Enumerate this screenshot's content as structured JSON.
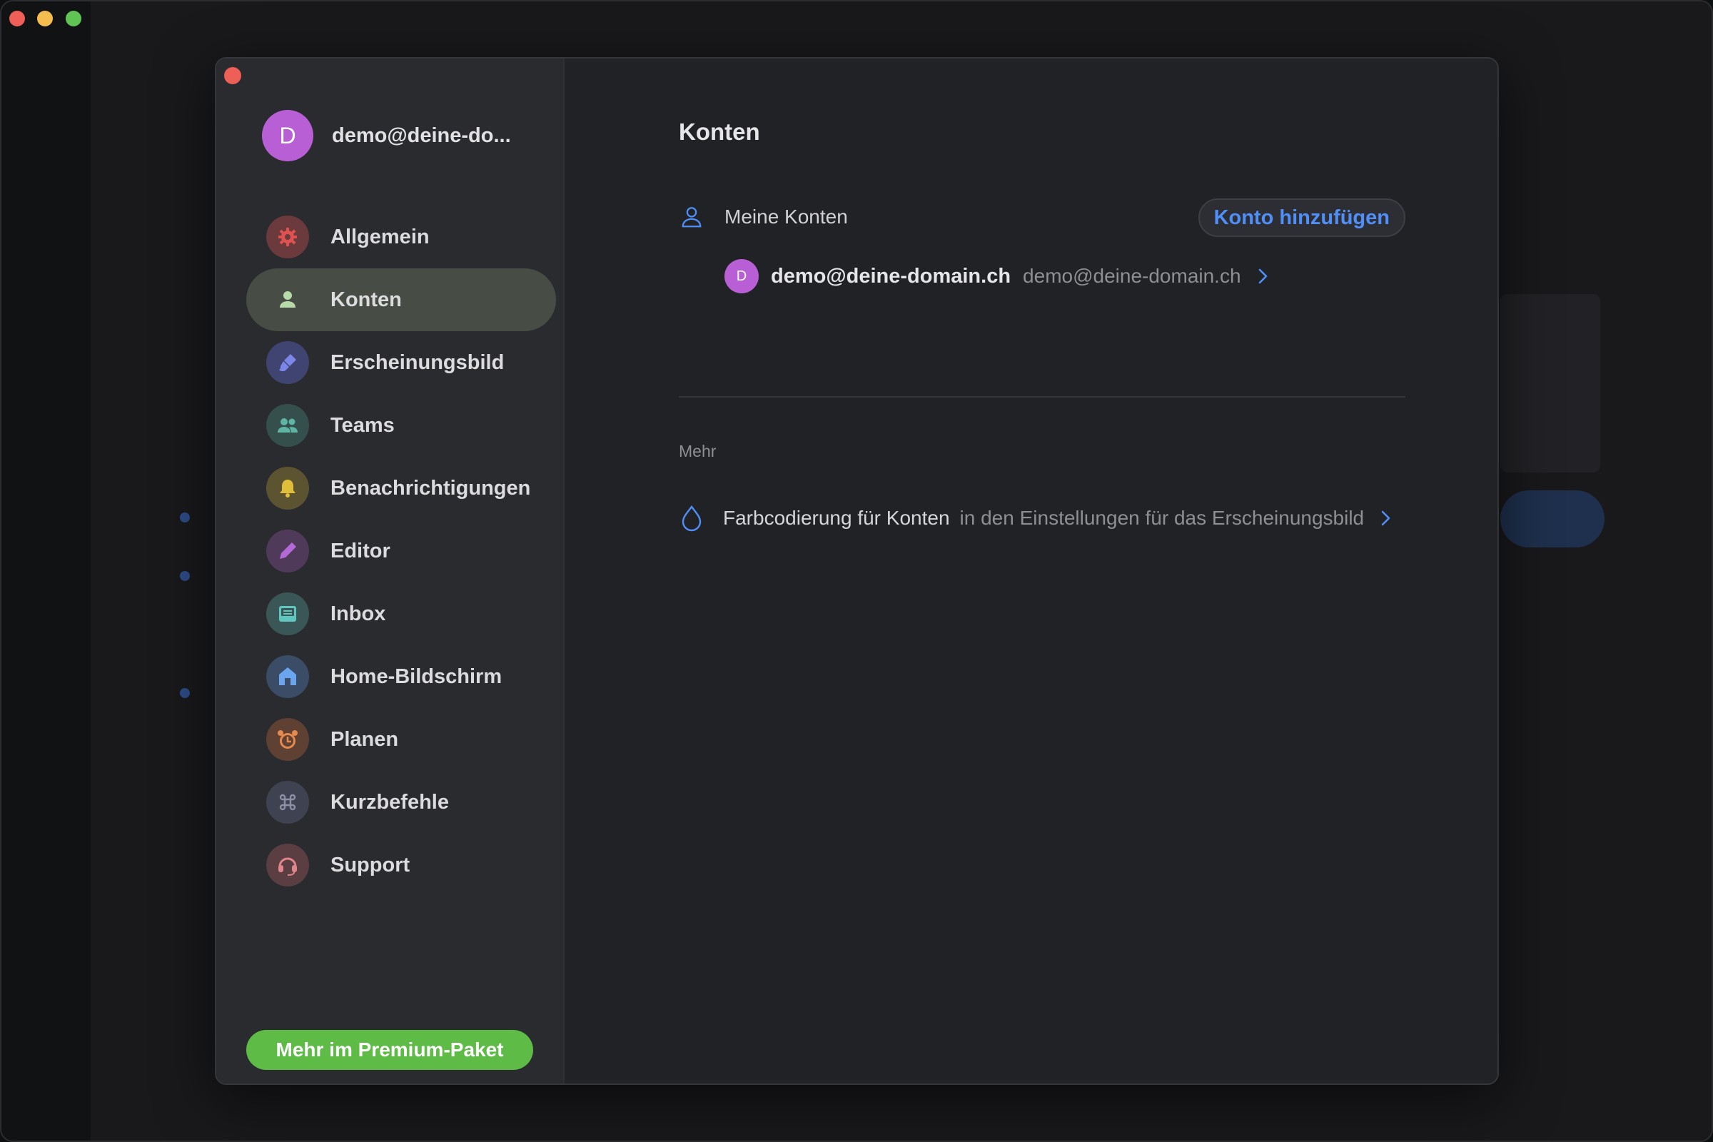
{
  "colors": {
    "accent": "#4f8ff7",
    "premium": "#5dbb46",
    "avatar": "#b95fd6",
    "active_nav": "#474c44"
  },
  "sidebar": {
    "account": {
      "avatar_letter": "D",
      "label": "demo@deine-do..."
    },
    "items": [
      {
        "label": "Allgemein",
        "icon": "gear-icon",
        "bg": "#6b3a3d",
        "fg": "#e0524f"
      },
      {
        "label": "Konten",
        "icon": "person-icon",
        "bg": "#474c44",
        "fg": "#b8d9a8",
        "active": true
      },
      {
        "label": "Erscheinungsbild",
        "icon": "brush-icon",
        "bg": "#3f4570",
        "fg": "#7b86e8"
      },
      {
        "label": "Teams",
        "icon": "people-icon",
        "bg": "#35504c",
        "fg": "#5fb5a4"
      },
      {
        "label": "Benachrichtigungen",
        "icon": "bell-icon",
        "bg": "#5c5330",
        "fg": "#e0be3a"
      },
      {
        "label": "Editor",
        "icon": "pen-icon",
        "bg": "#4f3a5a",
        "fg": "#b46ad6"
      },
      {
        "label": "Inbox",
        "icon": "inbox-icon",
        "bg": "#3b5656",
        "fg": "#5fc6c0"
      },
      {
        "label": "Home-Bildschirm",
        "icon": "home-icon",
        "bg": "#3a4c66",
        "fg": "#6aa5ee"
      },
      {
        "label": "Planen",
        "icon": "alarm-clock-icon",
        "bg": "#5e4132",
        "fg": "#e58a4f"
      },
      {
        "label": "Kurzbefehle",
        "icon": "command-icon",
        "bg": "#3f4250",
        "fg": "#8c90a6"
      },
      {
        "label": "Support",
        "icon": "headset-icon",
        "bg": "#5a3e42",
        "fg": "#e0858c"
      }
    ],
    "premium_button": "Mehr im Premium-Paket"
  },
  "content": {
    "title": "Konten",
    "my_accounts": {
      "label": "Meine Konten",
      "add_button": "Konto hinzufügen",
      "account": {
        "avatar_letter": "D",
        "name": "demo@deine-domain.ch",
        "email": "demo@deine-domain.ch"
      }
    },
    "more": {
      "label": "Mehr",
      "row_title": "Farbcodierung für Konten",
      "row_desc": "in den Einstellungen für das Erscheinungsbild"
    }
  }
}
